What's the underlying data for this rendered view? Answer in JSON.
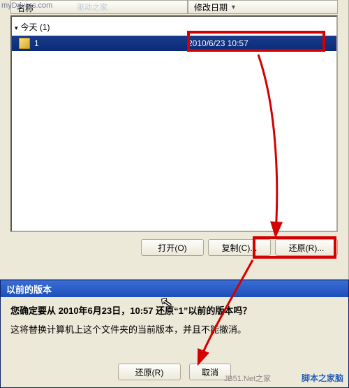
{
  "watermarks": {
    "top_left": "myDrivers.com",
    "top_left2": "驱动之家",
    "bottom_right": "脚本之家脑",
    "bottom_right2": "JB51.Net之家"
  },
  "columns": {
    "name": "名称",
    "date": "修改日期"
  },
  "group": {
    "label": "今天 (1)"
  },
  "item": {
    "name": "1",
    "date": "2010/6/23 10:57"
  },
  "buttons": {
    "open": "打开(O)",
    "copy": "复制(C)...",
    "restore": "还原(R)..."
  },
  "dialog": {
    "title": "以前的版本",
    "question_prefix": "您确定要从 ",
    "question_datetime": "2010年6月23日，10:57",
    "question_mid": " 还原“",
    "question_item": "1",
    "question_suffix": "”以前的版本吗？",
    "info": "这将替换计算机上这个文件夹的当前版本，并且不能撤消。",
    "restore_btn": "还原(R)",
    "cancel_btn": "取消"
  }
}
